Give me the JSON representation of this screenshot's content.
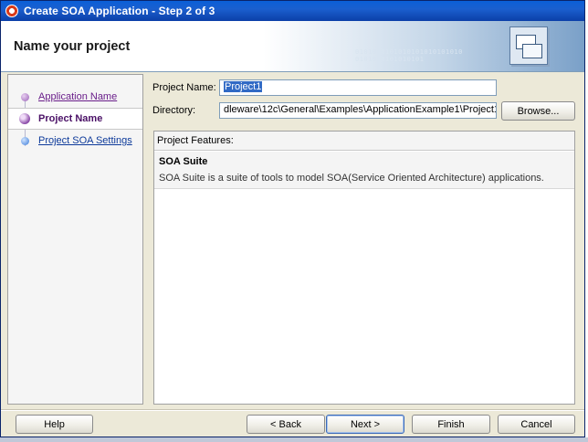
{
  "window": {
    "title": "Create SOA Application - Step 2 of 3"
  },
  "header": {
    "title": "Name your project",
    "decoration": "0101010101010101010101010\n0101010101010101"
  },
  "steps": [
    {
      "label": "Application Name",
      "state": "done"
    },
    {
      "label": "Project Name",
      "state": "current"
    },
    {
      "label": "Project SOA Settings",
      "state": "next"
    }
  ],
  "form": {
    "project_name_label": "Project Name:",
    "project_name_value": "Project1",
    "directory_label": "Directory:",
    "directory_value": "dleware\\12c\\General\\Examples\\ApplicationExample1\\Project1",
    "browse_label": "Browse..."
  },
  "features": {
    "header": "Project Features:",
    "items": [
      {
        "name": "SOA Suite",
        "description": "SOA Suite is a suite of tools to model SOA(Service Oriented Architecture) applications."
      }
    ]
  },
  "buttons": {
    "help": "Help",
    "back": "< Back",
    "next": "Next >",
    "finish": "Finish",
    "cancel": "Cancel"
  },
  "colors": {
    "title_bar": "#0a5fd8",
    "selection": "#316ac5",
    "step_done": "#6a1e8a",
    "step_next": "#0d3a9a"
  }
}
